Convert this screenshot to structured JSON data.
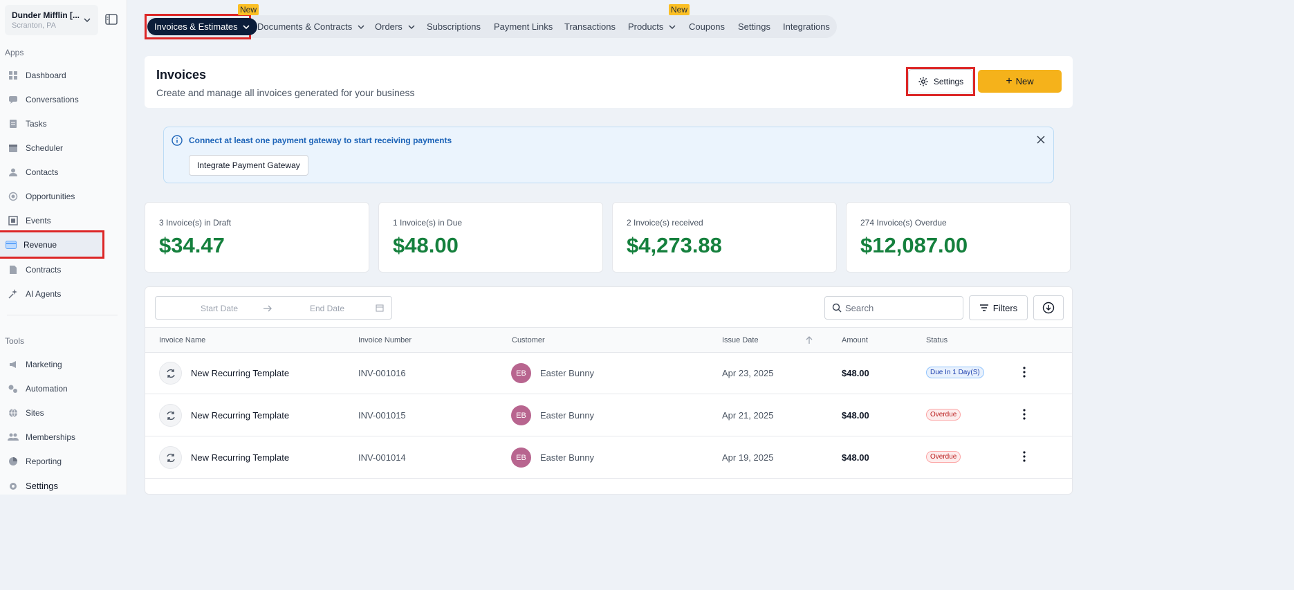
{
  "location": {
    "name": "Dunder Mifflin [...",
    "sub": "Scranton, PA"
  },
  "sidebar": {
    "apps_heading": "Apps",
    "tools_heading": "Tools",
    "apps": [
      {
        "label": "Dashboard",
        "icon": "dashboard-icon"
      },
      {
        "label": "Conversations",
        "icon": "chat-icon"
      },
      {
        "label": "Tasks",
        "icon": "tasks-icon"
      },
      {
        "label": "Scheduler",
        "icon": "calendar-icon"
      },
      {
        "label": "Contacts",
        "icon": "person-icon"
      },
      {
        "label": "Opportunities",
        "icon": "target-icon"
      },
      {
        "label": "Events",
        "icon": "events-icon"
      },
      {
        "label": "Revenue",
        "icon": "card-icon",
        "active": true
      },
      {
        "label": "Contracts",
        "icon": "document-icon"
      },
      {
        "label": "AI Agents",
        "icon": "sparkle-icon"
      }
    ],
    "tools": [
      {
        "label": "Marketing",
        "icon": "megaphone-icon"
      },
      {
        "label": "Automation",
        "icon": "gears-icon"
      },
      {
        "label": "Sites",
        "icon": "globe-icon"
      },
      {
        "label": "Memberships",
        "icon": "users-icon"
      },
      {
        "label": "Reporting",
        "icon": "pie-icon"
      },
      {
        "label": "Settings",
        "icon": "gear-icon"
      }
    ]
  },
  "tabs": {
    "invoices": "Invoices & Estimates",
    "documents": "Documents & Contracts",
    "orders": "Orders",
    "subscriptions": "Subscriptions",
    "payment_links": "Payment Links",
    "transactions": "Transactions",
    "products": "Products",
    "coupons": "Coupons",
    "settings": "Settings",
    "integrations": "Integrations",
    "new_badge": "New"
  },
  "header": {
    "title": "Invoices",
    "subtitle": "Create and manage all invoices generated for your business",
    "settings_label": "Settings",
    "new_label": "New"
  },
  "alert": {
    "message": "Connect at least one payment gateway to start receiving payments",
    "button": "Integrate Payment Gateway"
  },
  "stats": [
    {
      "label": "3 Invoice(s) in Draft",
      "value": "$34.47"
    },
    {
      "label": "1 Invoice(s) in Due",
      "value": "$48.00"
    },
    {
      "label": "2 Invoice(s) received",
      "value": "$4,273.88"
    },
    {
      "label": "274 Invoice(s) Overdue",
      "value": "$12,087.00"
    }
  ],
  "filters": {
    "start_placeholder": "Start Date",
    "end_placeholder": "End Date",
    "search_placeholder": "Search",
    "filters_label": "Filters"
  },
  "table": {
    "columns": {
      "name": "Invoice Name",
      "number": "Invoice Number",
      "customer": "Customer",
      "issue": "Issue Date",
      "amount": "Amount",
      "status": "Status"
    },
    "rows": [
      {
        "name": "New Recurring Template",
        "number": "INV-001016",
        "initials": "EB",
        "customer": "Easter Bunny",
        "issue": "Apr 23, 2025",
        "amount": "$48.00",
        "status": "Due In 1 Day(S)",
        "status_kind": "due"
      },
      {
        "name": "New Recurring Template",
        "number": "INV-001015",
        "initials": "EB",
        "customer": "Easter Bunny",
        "issue": "Apr 21, 2025",
        "amount": "$48.00",
        "status": "Overdue",
        "status_kind": "overdue"
      },
      {
        "name": "New Recurring Template",
        "number": "INV-001014",
        "initials": "EB",
        "customer": "Easter Bunny",
        "issue": "Apr 19, 2025",
        "amount": "$48.00",
        "status": "Overdue",
        "status_kind": "overdue"
      }
    ]
  }
}
